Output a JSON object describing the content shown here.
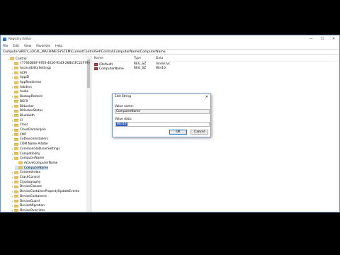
{
  "window": {
    "title": "Registry Editor",
    "minimize": "—",
    "maximize": "☐",
    "close": "✕"
  },
  "menu": [
    "File",
    "Edit",
    "View",
    "Favorites",
    "Help"
  ],
  "address": "Computer\\HKEY_LOCAL_MACHINE\\SYSTEM\\CurrentControlSet\\Control\\ComputerName\\ComputerName",
  "tree": [
    {
      "label": "Control",
      "chevron": "⌄",
      "indent": 8
    },
    {
      "label": "{7746D80F-97E0-4E26-9543-26B41FC22F79}",
      "chevron": "",
      "indent": 14
    },
    {
      "label": "AccessibilitySettings",
      "chevron": "›",
      "indent": 14
    },
    {
      "label": "ACPI",
      "chevron": "›",
      "indent": 14
    },
    {
      "label": "AppID",
      "chevron": "›",
      "indent": 14
    },
    {
      "label": "AppReadiness",
      "chevron": "",
      "indent": 14
    },
    {
      "label": "Arbiters",
      "chevron": "›",
      "indent": 14
    },
    {
      "label": "Audio",
      "chevron": "",
      "indent": 14
    },
    {
      "label": "BackupRestore",
      "chevron": "›",
      "indent": 14
    },
    {
      "label": "BGFX",
      "chevron": "",
      "indent": 14
    },
    {
      "label": "BitLocker",
      "chevron": "›",
      "indent": 14
    },
    {
      "label": "BitlockerStatus",
      "chevron": "",
      "indent": 14
    },
    {
      "label": "Bluetooth",
      "chevron": "›",
      "indent": 14
    },
    {
      "label": "CI",
      "chevron": "›",
      "indent": 14
    },
    {
      "label": "Class",
      "chevron": "›",
      "indent": 14
    },
    {
      "label": "CloudDomainJoin",
      "chevron": "›",
      "indent": 14
    },
    {
      "label": "CMF",
      "chevron": "›",
      "indent": 14
    },
    {
      "label": "CoDeviceInstallers",
      "chevron": "",
      "indent": 14
    },
    {
      "label": "COM Name Arbiter",
      "chevron": "",
      "indent": 14
    },
    {
      "label": "CommonGlobUserSettings",
      "chevron": "›",
      "indent": 14
    },
    {
      "label": "Compatibility",
      "chevron": "›",
      "indent": 14
    },
    {
      "label": "ComputerName",
      "chevron": "⌄",
      "indent": 14
    },
    {
      "label": "ActiveComputerName",
      "chevron": "",
      "indent": 20
    },
    {
      "label": "ComputerName",
      "chevron": "",
      "indent": 20,
      "selected": true
    },
    {
      "label": "ContentIndex",
      "chevron": "›",
      "indent": 14
    },
    {
      "label": "CrashControl",
      "chevron": "›",
      "indent": 14
    },
    {
      "label": "Cryptography",
      "chevron": "›",
      "indent": 14
    },
    {
      "label": "DeviceClasses",
      "chevron": "›",
      "indent": 14
    },
    {
      "label": "DeviceContainerPropertyUpdateEvents",
      "chevron": "›",
      "indent": 14
    },
    {
      "label": "DeviceContainers",
      "chevron": "›",
      "indent": 14
    },
    {
      "label": "DeviceGuard",
      "chevron": "›",
      "indent": 14
    },
    {
      "label": "DeviceMigration",
      "chevron": "›",
      "indent": 14
    },
    {
      "label": "DeviceOverrides",
      "chevron": "›",
      "indent": 14
    }
  ],
  "list": {
    "headers": [
      "Name",
      "Type",
      "Data"
    ],
    "rows": [
      {
        "name": "(Default)",
        "type": "REG_SZ",
        "data": "mnmsrvc"
      },
      {
        "name": "ComputerName",
        "type": "REG_SZ",
        "data": "Win10"
      }
    ]
  },
  "dialog": {
    "title": "Edit String",
    "close": "✕",
    "value_name_label": "Value name:",
    "value_name": "ComputerName",
    "value_data_label": "Value data:",
    "value_data": "Win10",
    "ok": "OK",
    "cancel": "Cancel"
  },
  "colors": {
    "selection": "#2a62c4",
    "folder": "#e8c35a"
  }
}
